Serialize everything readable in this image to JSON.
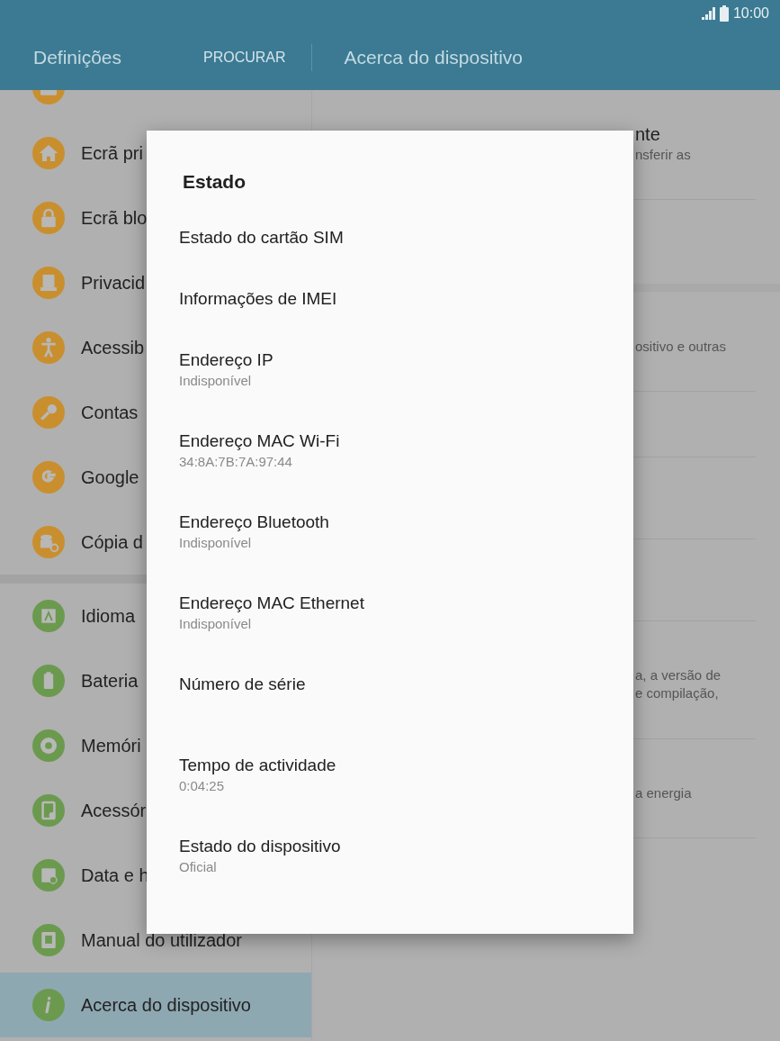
{
  "status_bar": {
    "time": "10:00"
  },
  "header": {
    "title": "Definições",
    "search": "PROCURAR",
    "page_title": "Acerca do dispositivo"
  },
  "sidebar": {
    "items": [
      {
        "label": "Ecrã pri",
        "color": "#c98f2e",
        "selected": false
      },
      {
        "label": "Ecrã blo",
        "color": "#c98f2e",
        "selected": false
      },
      {
        "label": "Privacid",
        "color": "#c98f2e",
        "selected": false
      },
      {
        "label": "Acessib",
        "color": "#c98f2e",
        "selected": false
      },
      {
        "label": "Contas",
        "color": "#c98f2e",
        "selected": false
      },
      {
        "label": "Google",
        "color": "#c98f2e",
        "selected": false
      },
      {
        "label": "Cópia d",
        "color": "#c98f2e",
        "selected": false
      },
      {
        "label": "Idioma",
        "color": "#6b9a4f",
        "selected": false
      },
      {
        "label": "Bateria",
        "color": "#6b9a4f",
        "selected": false
      },
      {
        "label": "Memóri",
        "color": "#6b9a4f",
        "selected": false
      },
      {
        "label": "Acessór",
        "color": "#6b9a4f",
        "selected": false
      },
      {
        "label": "Data e h",
        "color": "#6b9a4f",
        "selected": false
      },
      {
        "label": "Manual do utilizador",
        "color": "#6b9a4f",
        "selected": false
      },
      {
        "label": "Acerca do dispositivo",
        "color": "#6b9a4f",
        "selected": true
      }
    ]
  },
  "right_panel": {
    "fragments": [
      {
        "text": "nte",
        "kind": "title"
      },
      {
        "text": "nsferir as",
        "kind": "sub"
      },
      {
        "text": "ositivo e outras",
        "kind": "sub"
      },
      {
        "text": "a, a versão de",
        "kind": "sub"
      },
      {
        "text": "e compilação,",
        "kind": "sub"
      },
      {
        "text": "a energia",
        "kind": "sub"
      }
    ]
  },
  "dialog": {
    "title": "Estado",
    "items": [
      {
        "kind": "single",
        "title": "Estado do cartão SIM"
      },
      {
        "kind": "single",
        "title": "Informações de IMEI"
      },
      {
        "kind": "detail",
        "title": "Endereço IP",
        "subtitle": "Indisponível"
      },
      {
        "kind": "detail",
        "title": "Endereço MAC Wi-Fi",
        "subtitle": "34:8A:7B:7A:97:44"
      },
      {
        "kind": "detail",
        "title": "Endereço Bluetooth",
        "subtitle": "Indisponível"
      },
      {
        "kind": "detail",
        "title": "Endereço MAC Ethernet",
        "subtitle": "Indisponível"
      },
      {
        "kind": "detail",
        "title": "Número de série"
      },
      {
        "kind": "detail",
        "title": "Tempo de actividade",
        "subtitle": "0:04:25"
      },
      {
        "kind": "detail",
        "title": "Estado do dispositivo",
        "subtitle": "Oficial"
      }
    ]
  }
}
